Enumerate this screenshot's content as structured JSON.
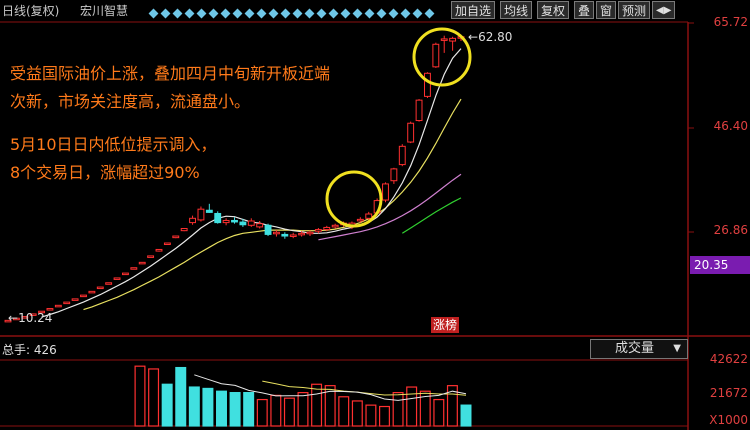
{
  "header": {
    "period": "日线(复权)",
    "name": "宏川智慧"
  },
  "toolbar": {
    "buttons": [
      "加自选",
      "均线",
      "复权",
      "叠",
      "窗",
      "预测"
    ],
    "nav": "◀▶"
  },
  "annotations": {
    "line1": "受益国际油价上涨，叠加四月中旬新开板近端",
    "line2": "次新，市场关注度高，流通盘小。",
    "line3": "5月10日日内低位提示调入，",
    "line4": "8个交易日，涨幅超过90%"
  },
  "price_axis": {
    "ticks": [
      "65.72",
      "46.40",
      "26.86"
    ],
    "current": "20.35"
  },
  "markers": {
    "high": "62.80",
    "low": "10.24",
    "limit_tag": "涨榜"
  },
  "volume": {
    "title": "总手: 426",
    "selector": "成交量",
    "ticks": [
      "42622",
      "21672",
      "X1000"
    ]
  },
  "colors": {
    "up": "#ff3030",
    "down": "#40e0e0",
    "ma5": "#e8e8e8",
    "ma10": "#e8e060",
    "ma20": "#d080d0",
    "ma30": "#30d030",
    "axis": "#8a1010"
  },
  "chart_data": {
    "type": "candlestick",
    "ylim": [
      8,
      68
    ],
    "candles": [
      [
        9.6,
        9.8,
        9.5,
        9.8
      ],
      [
        10.0,
        10.2,
        9.9,
        10.2
      ],
      [
        10.4,
        10.5,
        10.3,
        10.5
      ],
      [
        10.8,
        11.0,
        10.7,
        11.0
      ],
      [
        11.3,
        11.5,
        11.2,
        11.5
      ],
      [
        11.8,
        12.0,
        11.7,
        12.0
      ],
      [
        12.4,
        12.6,
        12.3,
        12.6
      ],
      [
        13.0,
        13.2,
        12.9,
        13.2
      ],
      [
        13.6,
        13.8,
        13.5,
        13.8
      ],
      [
        14.3,
        14.5,
        14.2,
        14.5
      ],
      [
        15.0,
        15.2,
        14.9,
        15.2
      ],
      [
        15.8,
        16.0,
        15.7,
        16.0
      ],
      [
        16.6,
        16.8,
        16.5,
        16.8
      ],
      [
        17.5,
        17.7,
        17.4,
        17.7
      ],
      [
        18.4,
        18.6,
        18.3,
        18.6
      ],
      [
        19.4,
        19.6,
        19.3,
        19.6
      ],
      [
        20.4,
        20.6,
        20.3,
        20.6
      ],
      [
        21.6,
        21.8,
        21.5,
        21.8
      ],
      [
        22.7,
        23.0,
        22.6,
        23.0
      ],
      [
        24.0,
        24.2,
        23.9,
        24.2
      ],
      [
        25.2,
        25.5,
        25.1,
        25.5
      ],
      [
        26.5,
        26.9,
        26.4,
        26.9
      ],
      [
        28.0,
        29.3,
        27.6,
        28.8
      ],
      [
        28.5,
        31.0,
        28.2,
        30.5
      ],
      [
        30.3,
        31.5,
        29.8,
        29.9
      ],
      [
        29.7,
        30.1,
        27.8,
        28.0
      ],
      [
        28.0,
        28.8,
        27.5,
        28.4
      ],
      [
        28.4,
        29.0,
        27.8,
        28.2
      ],
      [
        28.1,
        28.7,
        27.2,
        27.6
      ],
      [
        27.5,
        28.8,
        27.2,
        28.3
      ],
      [
        27.2,
        28.3,
        26.9,
        27.8
      ],
      [
        27.5,
        27.8,
        25.5,
        25.8
      ],
      [
        26.0,
        26.6,
        25.4,
        26.2
      ],
      [
        25.8,
        26.2,
        25.0,
        25.5
      ],
      [
        25.5,
        26.1,
        25.1,
        25.7
      ],
      [
        25.9,
        26.4,
        25.4,
        26.0
      ],
      [
        26.0,
        26.5,
        25.5,
        26.2
      ],
      [
        26.4,
        27.0,
        26.0,
        26.7
      ],
      [
        26.7,
        27.4,
        26.4,
        27.1
      ],
      [
        27.2,
        27.8,
        26.9,
        27.5
      ],
      [
        27.6,
        28.2,
        27.2,
        27.9
      ],
      [
        27.2,
        28.2,
        26.8,
        27.9
      ],
      [
        28.4,
        29.0,
        28.0,
        28.6
      ],
      [
        28.8,
        30.0,
        28.5,
        29.6
      ],
      [
        29.8,
        32.5,
        29.4,
        32.1
      ],
      [
        32.2,
        35.5,
        31.8,
        35.2
      ],
      [
        35.8,
        38.2,
        35.2,
        38.0
      ],
      [
        38.8,
        42.6,
        38.5,
        42.2
      ],
      [
        43.0,
        46.8,
        42.8,
        46.5
      ],
      [
        47.0,
        51.0,
        46.8,
        50.8
      ],
      [
        51.5,
        56.0,
        51.2,
        55.8
      ],
      [
        57.0,
        61.5,
        56.8,
        61.2
      ],
      [
        62.0,
        62.8,
        59.6,
        62.2
      ],
      [
        61.8,
        62.6,
        60.0,
        62.3
      ],
      [
        62.4,
        63.0,
        61.8,
        62.6
      ]
    ],
    "ma5": [
      null,
      null,
      null,
      null,
      10.4,
      10.9,
      11.4,
      12.0,
      12.6,
      13.2,
      13.9,
      14.6,
      15.4,
      16.2,
      17.0,
      17.9,
      18.9,
      19.9,
      21.0,
      22.1,
      23.2,
      24.4,
      25.7,
      27.0,
      28.0,
      28.8,
      29.2,
      29.1,
      28.6,
      28.1,
      27.9,
      27.5,
      27.2,
      26.8,
      26.5,
      26.3,
      26.0,
      26.0,
      26.1,
      26.4,
      26.8,
      27.1,
      27.5,
      28.0,
      29.0,
      30.6,
      32.8,
      35.4,
      38.6,
      42.5,
      47.0,
      51.6,
      55.6,
      58.6,
      60.4
    ],
    "ma10": [
      null,
      null,
      null,
      null,
      null,
      null,
      null,
      null,
      null,
      11.8,
      12.3,
      12.9,
      13.5,
      14.1,
      14.8,
      15.5,
      16.3,
      17.1,
      17.9,
      18.8,
      19.7,
      20.6,
      21.6,
      22.5,
      23.4,
      24.3,
      25.0,
      25.6,
      26.0,
      26.2,
      26.4,
      26.6,
      26.6,
      26.6,
      26.6,
      26.5,
      26.5,
      26.5,
      26.6,
      26.8,
      27.1,
      27.5,
      28.0,
      28.7,
      29.6,
      30.7,
      32.1,
      33.7,
      35.5,
      37.6,
      40.0,
      42.7,
      45.6,
      48.4,
      51.0
    ],
    "ma20": [
      null,
      null,
      null,
      null,
      null,
      null,
      null,
      null,
      null,
      null,
      null,
      null,
      null,
      null,
      null,
      null,
      null,
      null,
      null,
      null,
      null,
      null,
      null,
      null,
      null,
      null,
      null,
      null,
      null,
      null,
      null,
      null,
      null,
      null,
      null,
      null,
      null,
      24.8,
      25.1,
      25.4,
      25.7,
      26.0,
      26.3,
      26.7,
      27.2,
      27.8,
      28.5,
      29.3,
      30.2,
      31.2,
      32.3,
      33.5,
      34.7,
      35.9,
      37.0
    ],
    "ma30": [
      null,
      null,
      null,
      null,
      null,
      null,
      null,
      null,
      null,
      null,
      null,
      null,
      null,
      null,
      null,
      null,
      null,
      null,
      null,
      null,
      null,
      null,
      null,
      null,
      null,
      null,
      null,
      null,
      null,
      null,
      null,
      null,
      null,
      null,
      null,
      null,
      null,
      null,
      null,
      null,
      null,
      null,
      null,
      null,
      null,
      null,
      null,
      26.0,
      27.0,
      28.0,
      29.0,
      30.0,
      30.9,
      31.8,
      32.6
    ],
    "volume": {
      "values": [
        43000,
        41000,
        30000,
        42000,
        28000,
        27000,
        25000,
        24000,
        24000,
        19000,
        22000,
        20000,
        24000,
        30000,
        29000,
        21000,
        18000,
        15000,
        14000,
        24000,
        28000,
        25000,
        19000,
        29000,
        15000
      ],
      "up": [
        1,
        1,
        0,
        0,
        0,
        0,
        0,
        0,
        0,
        1,
        1,
        1,
        1,
        1,
        1,
        1,
        1,
        1,
        1,
        1,
        1,
        1,
        1,
        1,
        0
      ],
      "ma5": [
        null,
        null,
        null,
        null,
        36800,
        33600,
        30400,
        29200,
        25600,
        23800,
        21600,
        21800,
        21800,
        23000,
        25000,
        24800,
        24400,
        22600,
        19400,
        18400,
        19800,
        21200,
        22000,
        25000,
        23200
      ],
      "ma10": [
        null,
        null,
        null,
        null,
        null,
        null,
        null,
        null,
        null,
        32300,
        30400,
        28300,
        27700,
        26500,
        26300,
        25100,
        24400,
        23300,
        22300,
        22400,
        23000,
        23500,
        23000,
        23000,
        22100
      ],
      "ylim": [
        0,
        46000
      ]
    }
  }
}
